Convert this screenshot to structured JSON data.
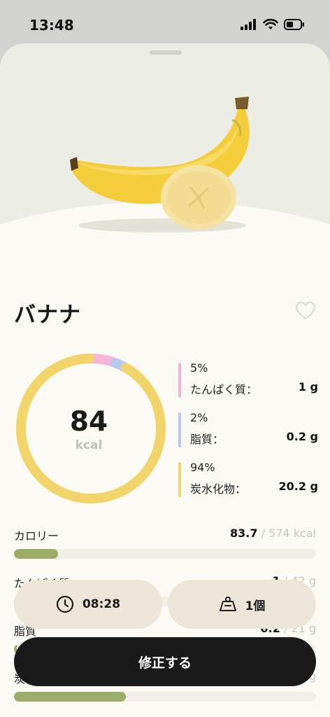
{
  "status_bar": {
    "time": "13:48"
  },
  "food": {
    "name": "バナナ"
  },
  "summary": {
    "kcal": "84",
    "unit": "kcal"
  },
  "macros": [
    {
      "percent": "5%",
      "label": "たんぱく質：",
      "amount": "1 g",
      "color": "#f3b5d8"
    },
    {
      "percent": "2%",
      "label": "脂質：",
      "amount": "0.2 g",
      "color": "#b8c9ee"
    },
    {
      "percent": "94%",
      "label": "炭水化物：",
      "amount": "20.2 g",
      "color": "#f2d56a"
    }
  ],
  "nutrition_rows": [
    {
      "label": "カロリー",
      "value": "83.7",
      "sep": " / ",
      "target": "574 kcal",
      "progress": 0.146
    },
    {
      "label": "たんぱく質",
      "value": "1",
      "sep": " / ",
      "target": "42 g",
      "progress": 0.02
    },
    {
      "label": "脂質",
      "value": "0.2",
      "sep": " / ",
      "target": "21 g",
      "progress": 0.01
    },
    {
      "label": "炭水化物",
      "value": "",
      "sep": "",
      "target": "g",
      "progress": 0.37
    }
  ],
  "actions": {
    "time": "08:28",
    "quantity": "1個",
    "edit": "修正する"
  },
  "colors": {
    "accent_green": "#9aae68",
    "button_dark": "#1a1a1a",
    "pill_bg": "#ede6d8"
  },
  "icons": {
    "time": "clock-icon",
    "quantity": "scale-icon",
    "favorite": "heart-icon"
  }
}
